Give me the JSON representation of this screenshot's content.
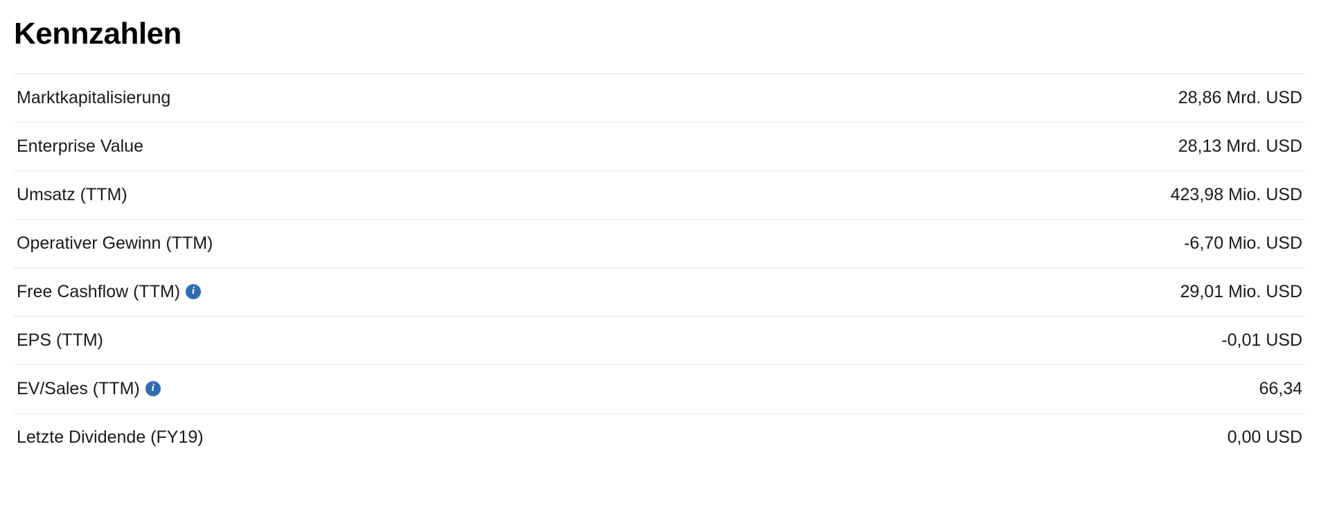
{
  "title": "Kennzahlen",
  "infoGlyph": "i",
  "metrics": [
    {
      "label": "Marktkapitalisierung",
      "value": "28,86 Mrd. USD",
      "hasInfo": false
    },
    {
      "label": "Enterprise Value",
      "value": "28,13 Mrd. USD",
      "hasInfo": false
    },
    {
      "label": "Umsatz (TTM)",
      "value": "423,98 Mio. USD",
      "hasInfo": false
    },
    {
      "label": "Operativer Gewinn (TTM)",
      "value": "-6,70 Mio. USD",
      "hasInfo": false
    },
    {
      "label": "Free Cashflow (TTM)",
      "value": "29,01 Mio. USD",
      "hasInfo": true
    },
    {
      "label": "EPS (TTM)",
      "value": "-0,01 USD",
      "hasInfo": false
    },
    {
      "label": "EV/Sales (TTM)",
      "value": "66,34",
      "hasInfo": true
    },
    {
      "label": "Letzte Dividende (FY19)",
      "value": "0,00 USD",
      "hasInfo": false
    }
  ]
}
